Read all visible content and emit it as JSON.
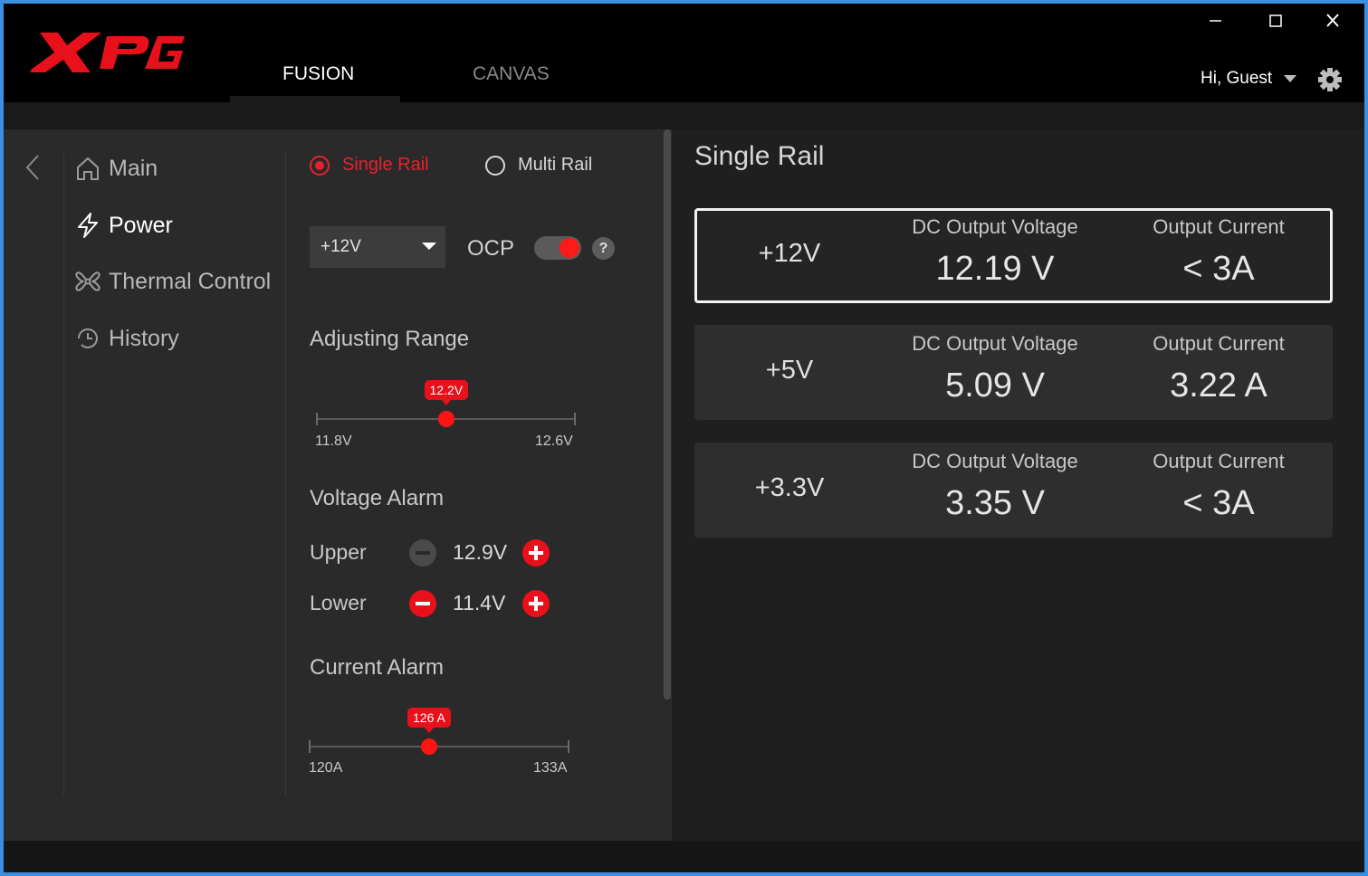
{
  "header": {
    "tabs": [
      {
        "label": "FUSION"
      },
      {
        "label": "CANVAS"
      }
    ],
    "user_greeting": "Hi, Guest",
    "icons": [
      "xpg-logo",
      "minimize-icon",
      "maximize-icon",
      "close-icon",
      "chevron-down-icon",
      "gear-icon"
    ]
  },
  "sidebar": {
    "items": [
      {
        "label": "Main",
        "icon": "home-icon"
      },
      {
        "label": "Power",
        "icon": "lightning-icon"
      },
      {
        "label": "Thermal Control",
        "icon": "fan-icon"
      },
      {
        "label": "History",
        "icon": "history-icon"
      }
    ]
  },
  "settings": {
    "rail_modes": [
      "Single Rail",
      "Multi Rail"
    ],
    "selected_rail": "+12V",
    "ocp_label": "OCP",
    "ocp_enabled": true,
    "help_label": "?",
    "adjusting_range": {
      "title": "Adjusting Range",
      "value": "12.2V",
      "min": "11.8V",
      "max": "12.6V",
      "fraction": 0.5
    },
    "voltage_alarm": {
      "title": "Voltage Alarm",
      "upper_label": "Upper",
      "upper_value": "12.9V",
      "lower_label": "Lower",
      "lower_value": "11.4V"
    },
    "current_alarm": {
      "title": "Current Alarm",
      "value": "126",
      "unit": "A",
      "min": "120A",
      "max": "133A",
      "fraction": 0.46
    }
  },
  "rail_panel": {
    "title": "Single Rail",
    "voltage_label": "DC Output Voltage",
    "current_label": "Output Current",
    "rails": [
      {
        "name": "+12V",
        "voltage": "12.19 V",
        "current": "< 3A"
      },
      {
        "name": "+5V",
        "voltage": "5.09 V",
        "current": "3.22 A"
      },
      {
        "name": "+3.3V",
        "voltage": "3.35 V",
        "current": "< 3A"
      }
    ]
  },
  "colors": {
    "accent": "#e8101a",
    "background": "#1f1f1f",
    "panel": "#2a2a2a",
    "window_border": "#3b8fe0"
  }
}
